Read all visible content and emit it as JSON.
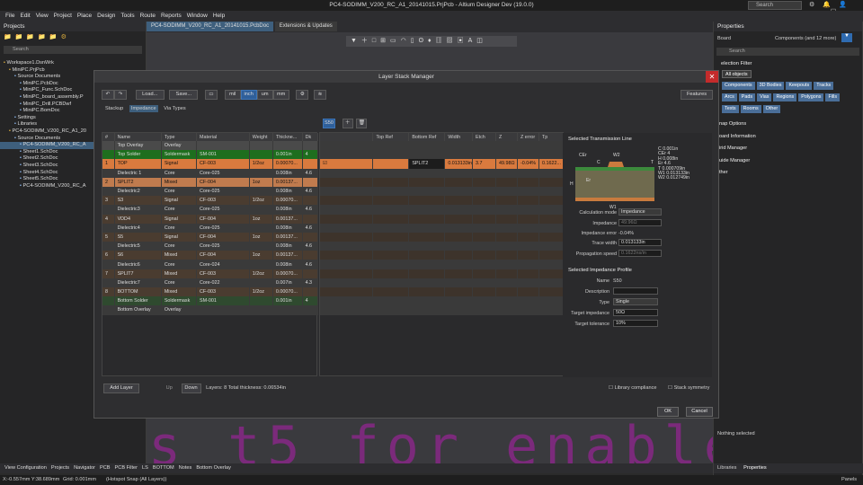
{
  "window": {
    "title": "PC4-SODIMM_V200_RC_A1_20141015.PrjPcb - Altium Designer Dev (19.0.0)",
    "search": "Search"
  },
  "menu": [
    "File",
    "Edit",
    "View",
    "Project",
    "Place",
    "Design",
    "Tools",
    "Route",
    "Reports",
    "Window",
    "Help"
  ],
  "projects": {
    "title": "Projects",
    "search": "Search",
    "tree": [
      {
        "t": "Workspace1.DsnWrk",
        "i": 0
      },
      {
        "t": "MiniPC.PrjPcb",
        "i": 1
      },
      {
        "t": "Source Documents",
        "i": 2
      },
      {
        "t": "MiniPC.PcbDoc",
        "i": 3
      },
      {
        "t": "MiniPC_Func.SchDoc",
        "i": 3
      },
      {
        "t": "MiniPC_board_assembly.P",
        "i": 3
      },
      {
        "t": "MiniPC_Drill.PCBDwf",
        "i": 3
      },
      {
        "t": "MiniPC.BomDoc",
        "i": 3
      },
      {
        "t": "Settings",
        "i": 2
      },
      {
        "t": "Libraries",
        "i": 2
      },
      {
        "t": "PC4-SODIMM_V200_RC_A1_20",
        "i": 1
      },
      {
        "t": "Source Documents",
        "i": 2
      },
      {
        "t": "PC4-SODIMM_V200_RC_A",
        "i": 3,
        "sel": true
      },
      {
        "t": "Sheet1.SchDoc",
        "i": 3
      },
      {
        "t": "Sheet2.SchDoc",
        "i": 3
      },
      {
        "t": "Sheet3.SchDoc",
        "i": 3
      },
      {
        "t": "Sheet4.SchDoc",
        "i": 3
      },
      {
        "t": "Sheet5.SchDoc",
        "i": 3
      },
      {
        "t": "PC4-SODIMM_V200_RC_A",
        "i": 3
      }
    ]
  },
  "doctabs": [
    "PC4-SODIMM_V200_RC_A1_20141015.PcbDoc",
    "Extensions & Updates"
  ],
  "dialog": {
    "title": "Layer Stack Manager",
    "load": "Load...",
    "save": "Save...",
    "units": [
      "mil",
      "inch",
      "um",
      "mm"
    ],
    "features": "Features",
    "tabs": [
      "Stackup",
      "Impedance",
      "Via Types"
    ],
    "profile_btn": "S50",
    "headers": [
      "#",
      "Name",
      "Type",
      "Material",
      "Weight",
      "Thickne...",
      "Dk"
    ],
    "rows": [
      {
        "n": "",
        "name": "Top Overlay",
        "type": "Overlay",
        "mat": "",
        "w": "",
        "th": "",
        "dk": "",
        "cls": "rowgray"
      },
      {
        "n": "",
        "name": "Top Solder",
        "type": "Soldermask",
        "mat": "SM-001",
        "w": "",
        "th": "0.001in",
        "dk": "4",
        "cls": "rowgreen"
      },
      {
        "n": "1",
        "name": "TOP",
        "type": "Signal",
        "mat": "CF-003",
        "w": "1/2oz",
        "th": "0.00070...",
        "dk": "",
        "cls": "rowsel"
      },
      {
        "n": "",
        "name": "Dielectric 1",
        "type": "Core",
        "mat": "Core-025",
        "w": "",
        "th": "0.008in",
        "dk": "4.6",
        "cls": "rowdark"
      },
      {
        "n": "2",
        "name": "SPLIT2",
        "type": "Mixed",
        "mat": "CF-004",
        "w": "1oz",
        "th": "0.00137...",
        "dk": "",
        "cls": "rowmixed"
      },
      {
        "n": "",
        "name": "Dielectric2",
        "type": "Core",
        "mat": "Core-025",
        "w": "",
        "th": "0.008in",
        "dk": "4.6",
        "cls": "rowdark"
      },
      {
        "n": "3",
        "name": "S3",
        "type": "Signal",
        "mat": "CF-003",
        "w": "1/2oz",
        "th": "0.00070...",
        "dk": "",
        "cls": "rowbrown"
      },
      {
        "n": "",
        "name": "Dielectric3",
        "type": "Core",
        "mat": "Core-025",
        "w": "",
        "th": "0.008in",
        "dk": "4.6",
        "cls": "rowdark"
      },
      {
        "n": "4",
        "name": "VDD4",
        "type": "Signal",
        "mat": "CF-004",
        "w": "1oz",
        "th": "0.00137...",
        "dk": "",
        "cls": "rowbrown"
      },
      {
        "n": "",
        "name": "Dielectric4",
        "type": "Core",
        "mat": "Core-025",
        "w": "",
        "th": "0.008in",
        "dk": "4.6",
        "cls": "rowdark"
      },
      {
        "n": "5",
        "name": "S5",
        "type": "Signal",
        "mat": "CF-004",
        "w": "1oz",
        "th": "0.00137...",
        "dk": "",
        "cls": "rowbrown"
      },
      {
        "n": "",
        "name": "Dielectric5",
        "type": "Core",
        "mat": "Core-025",
        "w": "",
        "th": "0.008in",
        "dk": "4.6",
        "cls": "rowdark"
      },
      {
        "n": "6",
        "name": "S6",
        "type": "Mixed",
        "mat": "CF-004",
        "w": "1oz",
        "th": "0.00137...",
        "dk": "",
        "cls": "rowbrown"
      },
      {
        "n": "",
        "name": "Dielectric6",
        "type": "Core",
        "mat": "Core-024",
        "w": "",
        "th": "0.008in",
        "dk": "4.6",
        "cls": "rowdark"
      },
      {
        "n": "7",
        "name": "SPLIT7",
        "type": "Mixed",
        "mat": "CF-003",
        "w": "1/2oz",
        "th": "0.00070...",
        "dk": "",
        "cls": "rowbrown"
      },
      {
        "n": "",
        "name": "Dielectric7",
        "type": "Core",
        "mat": "Core-022",
        "w": "",
        "th": "0.007in",
        "dk": "4.3",
        "cls": "rowdark"
      },
      {
        "n": "8",
        "name": "BOTTOM",
        "type": "Mixed",
        "mat": "CF-003",
        "w": "1/2oz",
        "th": "0.00070...",
        "dk": "",
        "cls": "rowbrown"
      },
      {
        "n": "",
        "name": "Bottom Solder",
        "type": "Soldermask",
        "mat": "SM-001",
        "w": "",
        "th": "0.001in",
        "dk": "4",
        "cls": "rowgreenD"
      },
      {
        "n": "",
        "name": "Bottom Overlay",
        "type": "Overlay",
        "mat": "",
        "w": "",
        "th": "",
        "dk": "",
        "cls": "rowdark"
      }
    ],
    "imp_headers": [
      "Top Ref",
      "Bottom Ref",
      "Width",
      "Etch",
      "Z",
      "Z error",
      "Tp"
    ],
    "imp_selected": {
      "bottom_ref": "SPLIT2",
      "width": "0.013133in",
      "etch": "3.7",
      "z": "49.98Ω",
      "zerr": "-0.04%",
      "tp": "0.1622..."
    },
    "bottom": {
      "add": "Add Layer",
      "up": "Up",
      "down": "Down",
      "layers": "Layers: 8   Total thickness: 0.06534in",
      "lib": "Library compliance",
      "stack": "Stack symmetry"
    },
    "ok": "OK",
    "cancel": "Cancel",
    "tline": {
      "title": "Selected Transmission Line",
      "params": [
        "C 0.001in",
        "CEr 4",
        "H 0.008in",
        "Er 4.6",
        "T 0.000709in",
        "W1 0.013133in",
        "W2 0.012749in"
      ],
      "labels": [
        "CEr",
        "T",
        "W2",
        "C",
        "H",
        "Er",
        "W1"
      ],
      "calc_label": "Calculation mode",
      "calc": "Impedance",
      "imp_label": "Impedance",
      "imp": "49.96Ω",
      "err_label": "Impedance error",
      "err": "-0.04%",
      "tw_label": "Trace width",
      "tw": "0.013133in",
      "ps_label": "Propagation speed",
      "ps": "0.1622ns/in"
    },
    "profile": {
      "title": "Selected Impedance Profile",
      "name_label": "Name",
      "name": "S50",
      "desc_label": "Description",
      "desc": "",
      "type_label": "Type",
      "type": "Single",
      "ti_label": "Target impedance",
      "ti": "50Ω",
      "tt_label": "Target tolerance",
      "tt": "10%"
    }
  },
  "bigtext": "s t5 for enable",
  "props": {
    "title": "Properties",
    "board": "Board",
    "components": "Components (and 12 more)",
    "search": "Search",
    "filter": "election Filter",
    "all": "All objects",
    "chips": [
      "Components",
      "3D Bodies",
      "Keepouts",
      "Tracks",
      "Arcs",
      "Pads",
      "Vias",
      "Regions",
      "Polygons",
      "Fills",
      "Texts",
      "Rooms",
      "Other"
    ],
    "sections": [
      "nap Options",
      "oard Information",
      "irid Manager",
      "uide Manager",
      "ther"
    ],
    "nothing": "Nothing selected",
    "tabs": [
      "Libraries",
      "Properties"
    ]
  },
  "btmtabs": [
    "View Configuration",
    "Projects",
    "Navigator",
    "PCB",
    "PCB Filter",
    "LS",
    "BOTTOM",
    "Notes",
    "Bottom Overlay"
  ],
  "status": {
    "coords": "X:-0.557mm Y:38.689mm",
    "grid": "Grid: 0.001mm",
    "snap": "(Hotspot Snap (All Layers))",
    "panels": "Panels"
  }
}
